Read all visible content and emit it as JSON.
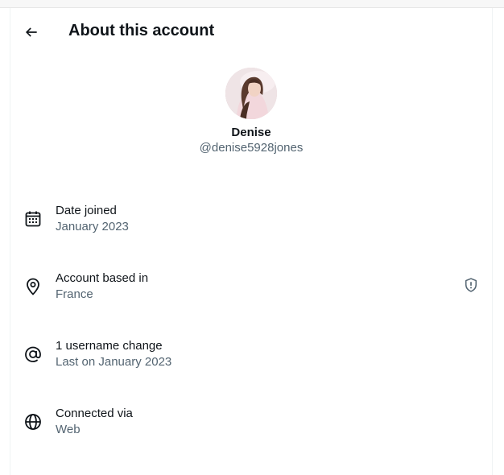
{
  "header": {
    "title": "About this account",
    "back_icon": "arrow-left-icon"
  },
  "profile": {
    "name": "Denise",
    "handle": "@denise5928jones"
  },
  "rows": [
    {
      "icon": "calendar-icon",
      "label": "Date joined",
      "value": "January 2023"
    },
    {
      "icon": "location-pin-icon",
      "label": "Account based in",
      "value": "France",
      "badge_icon": "shield-alert-icon"
    },
    {
      "icon": "at-sign-icon",
      "label": "1 username change",
      "value": "Last on January 2023"
    },
    {
      "icon": "globe-icon",
      "label": "Connected via",
      "value": "Web"
    }
  ],
  "colors": {
    "primary_text": "#0f1419",
    "secondary_text": "#536471",
    "border": "#eff3f4"
  }
}
